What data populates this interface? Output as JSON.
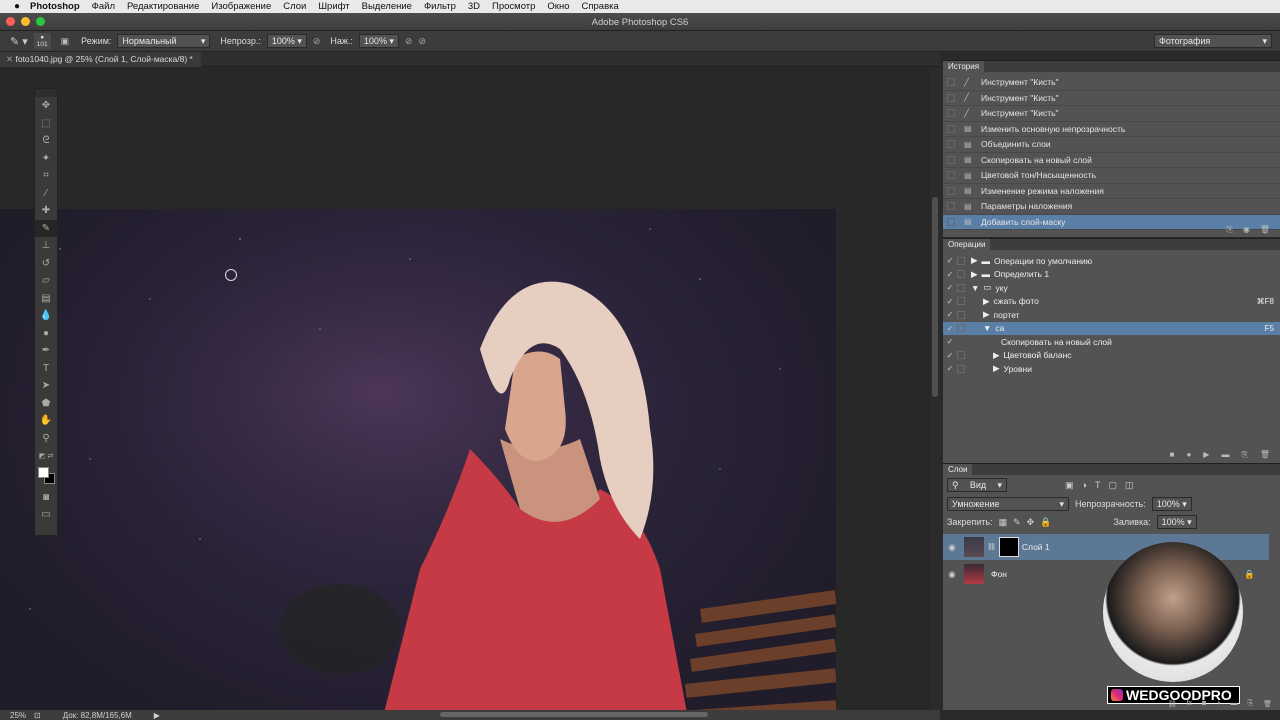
{
  "menubar": {
    "apple": "",
    "items": [
      "Photoshop",
      "Файл",
      "Редактирование",
      "Изображение",
      "Слои",
      "Шрифт",
      "Выделение",
      "Фильтр",
      "3D",
      "Просмотр",
      "Окно",
      "Справка"
    ]
  },
  "window": {
    "title": "Adobe Photoshop CS6"
  },
  "options": {
    "brush_size": "101",
    "mode_label": "Режим:",
    "mode_value": "Нормальный",
    "opacity_label": "Непрозр.:",
    "opacity_value": "100%",
    "pressure_label": "Наж.:",
    "pressure_value": "100%",
    "workspace": "Фотография"
  },
  "doc_tab": "foto1040.jpg @ 25% (Слой 1, Слой-маска/8) *",
  "status": {
    "zoom": "25%",
    "doc_size": "Док: 82,8M/165,6M"
  },
  "history": {
    "tab": "История",
    "items": [
      {
        "label": "Инструмент \"Кисть\"",
        "icon": "brush"
      },
      {
        "label": "Инструмент \"Кисть\"",
        "icon": "brush"
      },
      {
        "label": "Инструмент \"Кисть\"",
        "icon": "brush"
      },
      {
        "label": "Изменить основную непрозрачность",
        "icon": "doc"
      },
      {
        "label": "Объединить слои",
        "icon": "doc"
      },
      {
        "label": "Скопировать на новый слой",
        "icon": "doc"
      },
      {
        "label": "Цветовой тон/Насыщенность",
        "icon": "doc"
      },
      {
        "label": "Изменение режима наложения",
        "icon": "doc"
      },
      {
        "label": "Параметры наложения",
        "icon": "doc"
      },
      {
        "label": "Добавить слой-маску",
        "icon": "doc",
        "selected": true
      }
    ]
  },
  "actions": {
    "tab": "Операции",
    "items": [
      {
        "label": "Операции по умолчанию",
        "indent": 0,
        "folder": true,
        "key": ""
      },
      {
        "label": "Определить 1",
        "indent": 0,
        "folder": true,
        "key": ""
      },
      {
        "label": "уку",
        "indent": 0,
        "folder": true,
        "open": true,
        "key": ""
      },
      {
        "label": "сжать фото",
        "indent": 1,
        "key": "⌘F8"
      },
      {
        "label": "портет",
        "indent": 1,
        "key": ""
      },
      {
        "label": "са",
        "indent": 1,
        "open": true,
        "key": "F5",
        "selected": true
      },
      {
        "label": "Скопировать на новый слой",
        "indent": 2,
        "key": ""
      },
      {
        "label": "Цветовой баланс",
        "indent": 2,
        "key": "",
        "arrow": true
      },
      {
        "label": "Уровни",
        "indent": 2,
        "key": "",
        "arrow": true
      }
    ]
  },
  "layers": {
    "tab": "Слои",
    "filter": "Вид",
    "blend": "Умножение",
    "opacity_label": "Непрозрачность:",
    "opacity": "100%",
    "lock_label": "Закрепить:",
    "fill_label": "Заливка:",
    "fill": "100%",
    "items": [
      {
        "name": "Слой 1",
        "selected": true
      },
      {
        "name": "Фон"
      }
    ]
  },
  "watermark": "WEDGOODPRO"
}
